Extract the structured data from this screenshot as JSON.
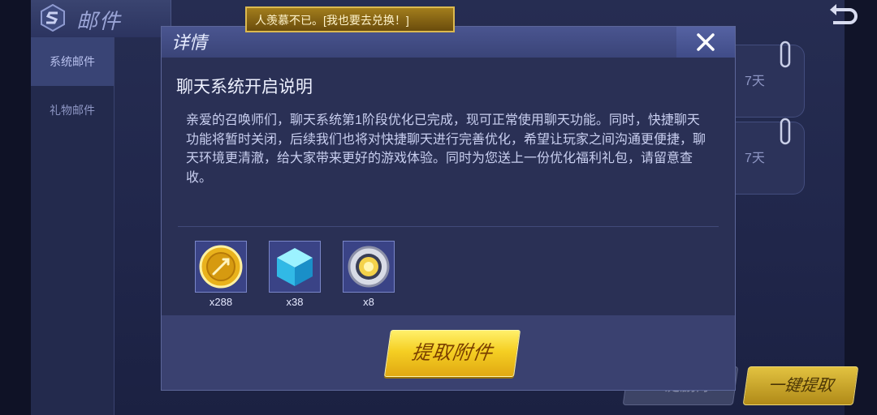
{
  "header": {
    "title": "邮件"
  },
  "side_nav": {
    "items": [
      "系统邮件",
      "礼物邮件"
    ]
  },
  "mail_list": {
    "ghost_title": "聊天系统开启说明",
    "items": [
      {
        "days": "7天"
      },
      {
        "days": "7天"
      }
    ]
  },
  "notice": {
    "text": "人羡慕不已。[我也要去兑换！]"
  },
  "modal": {
    "header_title": "详情",
    "mail_title": "聊天系统开启说明",
    "mail_body": "亲爱的召唤师们，聊天系统第1阶段优化已完成，现可正常使用聊天功能。同时，快捷聊天功能将暂时关闭，后续我们也将对快捷聊天进行完善优化，希望让玩家之间沟通更便捷，聊天环境更清澈，给大家带来更好的游戏体验。同时为您送上一份优化福利礼包，请留意查收。",
    "rewards": [
      {
        "icon": "gold-coin-icon",
        "qty": "x288"
      },
      {
        "icon": "blue-crystal-icon",
        "qty": "x38"
      },
      {
        "icon": "gold-sun-medal-icon",
        "qty": "x8"
      }
    ],
    "claim_label": "提取附件"
  },
  "bottom": {
    "delete_label": "一键删除",
    "collect_label": "一键提取"
  }
}
